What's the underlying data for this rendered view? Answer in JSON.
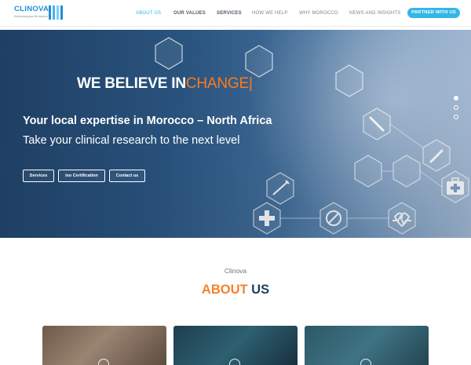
{
  "header": {
    "logo_name": "CLINOVA",
    "logo_tagline": "Embracing your life science",
    "nav": [
      {
        "label": "ABOUT US"
      },
      {
        "label": "OUR VALUES"
      },
      {
        "label": "SERVICES"
      },
      {
        "label": "HOW WE HELP"
      },
      {
        "label": "WHY MOROCCO"
      },
      {
        "label": "NEWS AND INSIGHTS"
      }
    ],
    "partner_label": "PARTNER WITH US"
  },
  "hero": {
    "headline_prefix": "WE BELIEVE IN",
    "headline_accent": "CHANGE|",
    "subtitle_1": "Your local expertise in Morocco – North Africa",
    "subtitle_2": "Take your clinical research to the next level",
    "buttons": [
      {
        "label": "Services"
      },
      {
        "label": "Iso Certification"
      },
      {
        "label": "Contact us"
      }
    ],
    "slides": 3,
    "active_slide": 1
  },
  "about": {
    "kicker": "Clinova",
    "title_accent": "ABOUT",
    "title_rest": " US"
  },
  "colors": {
    "brand_blue": "#1e8fd8",
    "nav_active": "#2bb3e4",
    "accent_orange": "#f5822a",
    "navy": "#1d3d5f"
  }
}
